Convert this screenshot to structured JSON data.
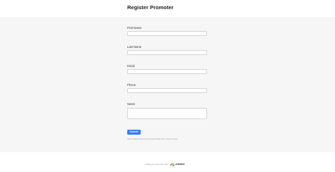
{
  "form": {
    "title": "Register Promoter",
    "fields": [
      {
        "label": "First Name",
        "value": "",
        "placeholder": ""
      },
      {
        "label": "Last Name",
        "value": "",
        "placeholder": ""
      },
      {
        "label": "Email",
        "value": "",
        "placeholder": ""
      },
      {
        "label": "Phone",
        "value": "",
        "placeholder": ""
      },
      {
        "label": "Notes",
        "value": "",
        "placeholder": ""
      }
    ],
    "submit_label": "Submit",
    "disclaimer": "Never submit passwords through Airtable forms. Report abuse"
  },
  "footer": {
    "text": "Create your own form with",
    "brand": "Airtable",
    "logo_icon": "airtable-logo-icon"
  },
  "colors": {
    "accent": "#2d7ff9",
    "form_background": "#f6f6f6"
  }
}
